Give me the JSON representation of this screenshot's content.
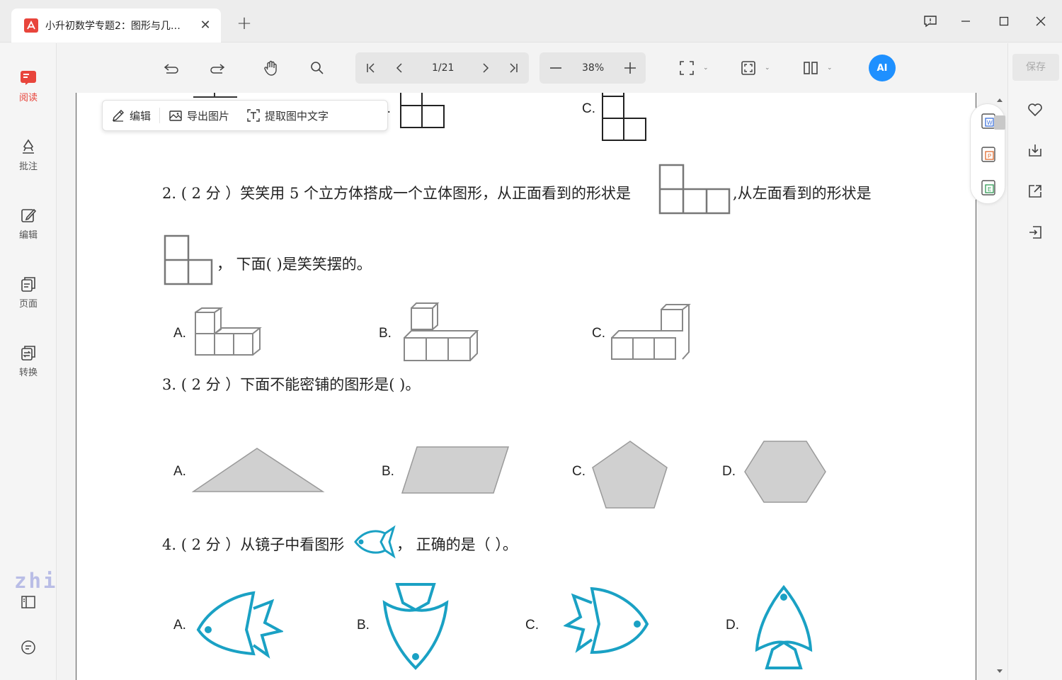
{
  "tab": {
    "title": "小升初数学专题2：图形与几…",
    "close": "✕"
  },
  "new_tab": "+",
  "sidebar": {
    "items": [
      {
        "label": "阅读"
      },
      {
        "label": "批注"
      },
      {
        "label": "编辑"
      },
      {
        "label": "页面"
      },
      {
        "label": "转换"
      }
    ],
    "watermark": "zhishi.im"
  },
  "toolbar": {
    "page": "1/21",
    "zoom": "38%",
    "ai": "AI"
  },
  "right": {
    "save": "保存"
  },
  "float_menu": {
    "edit": "编辑",
    "export": "导出图片",
    "extract": "提取图中文字"
  },
  "doc": {
    "q1_opt_b": "B.",
    "q1_opt_c": "C.",
    "q2_line1_a": "2. ( 2 分 ）笑笑用 5 个立方体搭成一个立体图形，从正面看到的形状是",
    "q2_line1_b": ",从左面看到的形状是",
    "q2_line2": "，  下面(      )是笑笑摆的。",
    "q2_opts": [
      "A.",
      "B.",
      "C."
    ],
    "q3_text": "3. ( 2 分 ）下面不能密铺的图形是(      )。",
    "q3_opts": [
      "A.",
      "B.",
      "C.",
      "D."
    ],
    "q4_text_a": "4. ( 2 分 ）从镜子中看图形",
    "q4_text_b": "，  正确的是（    ）。",
    "q4_opts": [
      "A.",
      "B.",
      "C.",
      "D."
    ]
  },
  "colors": {
    "accent": "#e8453c",
    "ai_blue": "#1e90ff",
    "fish": "#1aa1c4",
    "shape_fill": "#d0d0d0"
  }
}
